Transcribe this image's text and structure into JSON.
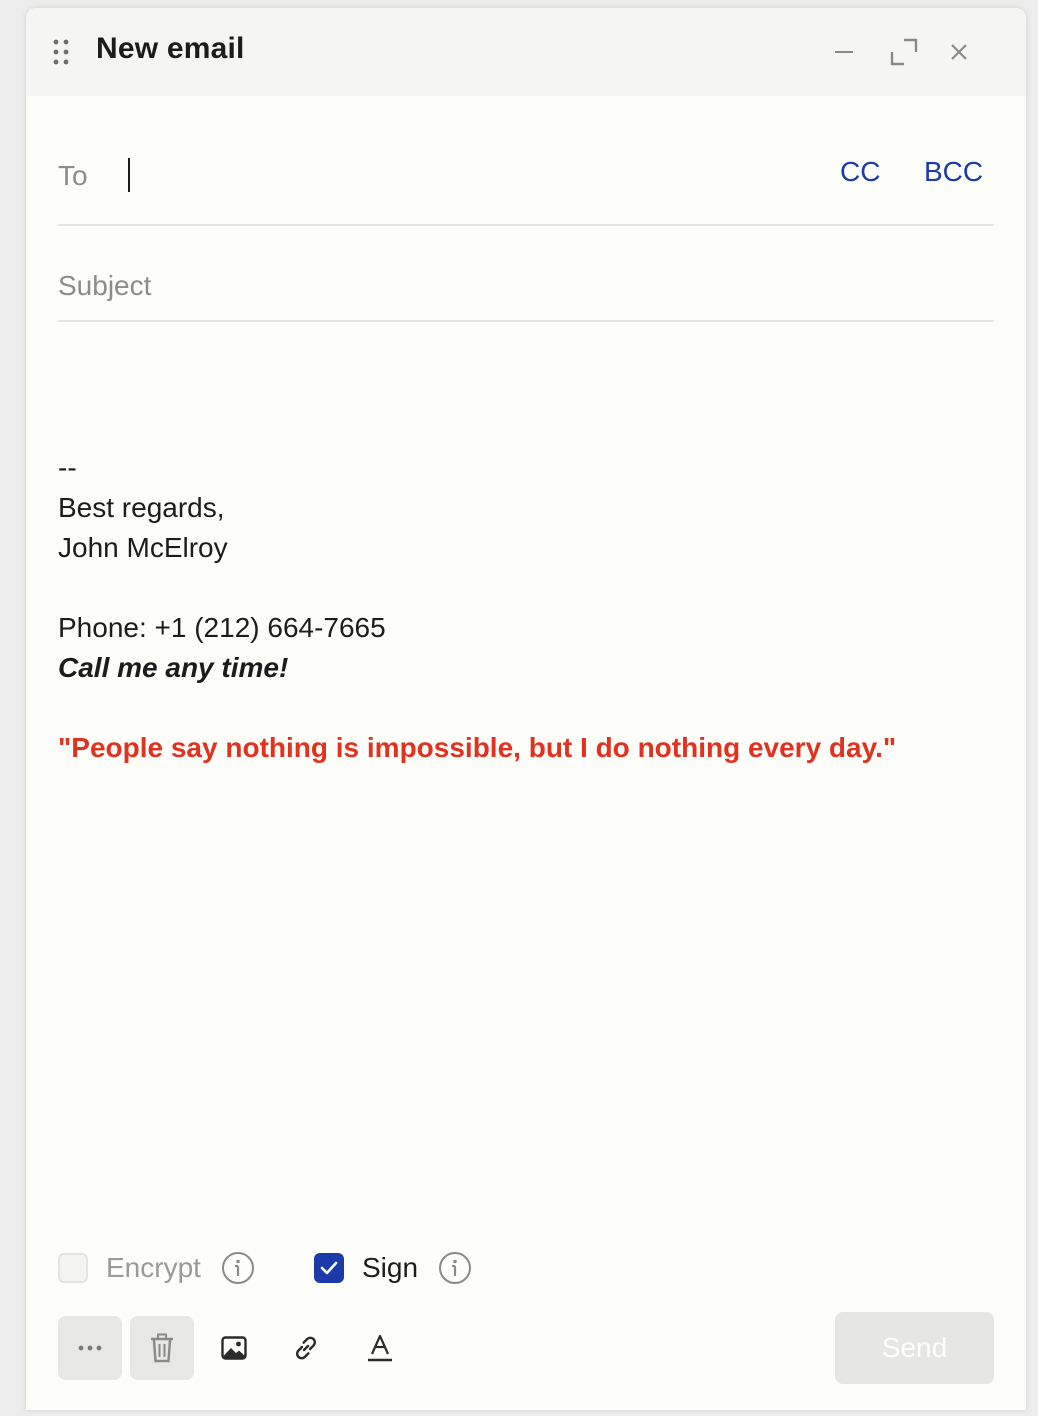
{
  "window": {
    "title": "New email"
  },
  "recipients": {
    "to_label": "To",
    "to_value": "",
    "cc_label": "CC",
    "bcc_label": "BCC"
  },
  "subject": {
    "placeholder": "Subject",
    "value": ""
  },
  "body": {
    "separator": "--",
    "closing": "Best regards,",
    "name": "John McElroy",
    "phone": "Phone: +1 (212) 664-7665",
    "tagline": "Call me any time!",
    "quote": "\"People say nothing is impossible, but I do nothing every day.\""
  },
  "options": {
    "encrypt": {
      "label": "Encrypt",
      "checked": false,
      "disabled": true
    },
    "sign": {
      "label": "Sign",
      "checked": true
    }
  },
  "toolbar": {
    "more_icon": "more-horizontal-icon",
    "delete_icon": "trash-icon",
    "image_icon": "image-icon",
    "link_icon": "link-icon",
    "format_icon": "text-format-icon"
  },
  "send": {
    "label": "Send"
  },
  "colors": {
    "accent": "#1c3aa9",
    "quote": "#e0321f",
    "disabled_button": "#e6e6e3"
  }
}
